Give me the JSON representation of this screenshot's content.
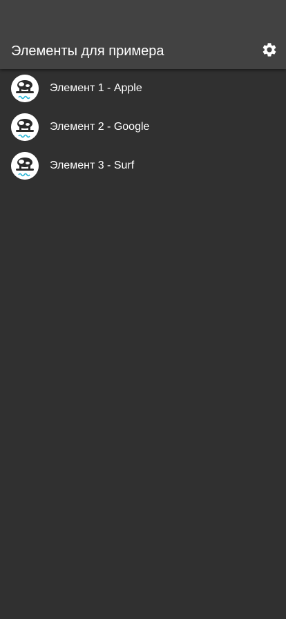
{
  "app_bar": {
    "title": "Элементы для примера",
    "settings_icon": "gear-icon"
  },
  "list": {
    "items": [
      {
        "label": "Элемент 1 - Apple",
        "avatar_icon": "surf-cow-logo"
      },
      {
        "label": "Элемент 2 - Google",
        "avatar_icon": "surf-cow-logo"
      },
      {
        "label": "Элемент 3 - Surf",
        "avatar_icon": "surf-cow-logo"
      }
    ]
  },
  "colors": {
    "background": "#303030",
    "app_bar": "#424242",
    "text": "#ffffff",
    "logo_accent": "#29b6d6"
  }
}
